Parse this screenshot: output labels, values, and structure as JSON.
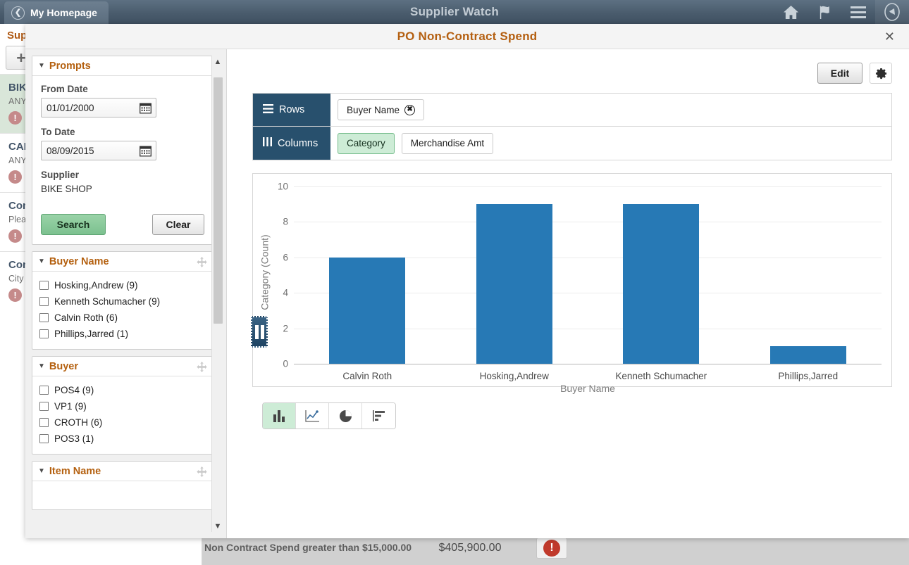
{
  "topbar": {
    "back_tab_label": "My Homepage",
    "title": "Supplier Watch",
    "icons": [
      "home-icon",
      "flag-icon",
      "hamburger-menu-icon",
      "navbar-compass-icon"
    ]
  },
  "background": {
    "panel_title": "Sup",
    "add_button_label": "+",
    "cards": [
      {
        "title": "BIK",
        "subtitle": "ANY",
        "warning": "V"
      },
      {
        "title": "CAN",
        "subtitle": "ANY",
        "warning": "V"
      },
      {
        "title": "Con",
        "subtitle": "Pleas",
        "warning": "V"
      },
      {
        "title": "Con",
        "subtitle": "City",
        "warning": "V"
      }
    ],
    "bottom_row": {
      "label": "Non Contract Spend greater than $15,000.00",
      "amount": "$405,900.00",
      "flag_icon": "alert-icon"
    }
  },
  "modal": {
    "title": "PO Non-Contract Spend",
    "close_label": "✕"
  },
  "prompts": {
    "header": "Prompts",
    "from_date_label": "From Date",
    "from_date_value": "01/01/2000",
    "to_date_label": "To Date",
    "to_date_value": "08/09/2015",
    "supplier_label": "Supplier",
    "supplier_value": "BIKE SHOP",
    "search_label": "Search",
    "clear_label": "Clear"
  },
  "facets": [
    {
      "header": "Buyer Name",
      "items": [
        "Hosking,Andrew (9)",
        "Kenneth Schumacher (9)",
        "Calvin Roth (6)",
        "Phillips,Jarred (1)"
      ]
    },
    {
      "header": "Buyer",
      "items": [
        "POS4 (9)",
        "VP1 (9)",
        "CROTH (6)",
        "POS3 (1)"
      ]
    },
    {
      "header": "Item Name",
      "items": []
    }
  ],
  "toolbar": {
    "edit_label": "Edit",
    "gear_icon": "gear-icon"
  },
  "pivot": {
    "rows_label": "Rows",
    "columns_label": "Columns",
    "rows_fields": [
      {
        "label": "Buyer Name",
        "removable": true
      }
    ],
    "columns_fields": [
      {
        "label": "Category",
        "selected": true
      },
      {
        "label": "Merchandise Amt",
        "selected": false
      }
    ]
  },
  "chart_types": [
    {
      "name": "bar-chart-icon",
      "active": true
    },
    {
      "name": "line-chart-icon",
      "active": false
    },
    {
      "name": "pie-chart-icon",
      "active": false
    },
    {
      "name": "horizontal-bar-chart-icon",
      "active": false
    }
  ],
  "chart_data": {
    "type": "bar",
    "title": "",
    "categories": [
      "Calvin Roth",
      "Hosking,Andrew",
      "Kenneth Schumacher",
      "Phillips,Jarred"
    ],
    "values": [
      6,
      9,
      9,
      1
    ],
    "series": [
      {
        "name": "Category (Count)",
        "values": [
          6,
          9,
          9,
          1
        ]
      }
    ],
    "xlabel": "Buyer Name",
    "ylabel": "Category (Count)",
    "ylim": [
      0,
      10
    ],
    "yticks": [
      0,
      2,
      4,
      6,
      8,
      10
    ],
    "grid": true,
    "legend": "none",
    "bar_color": "#2779b5"
  }
}
